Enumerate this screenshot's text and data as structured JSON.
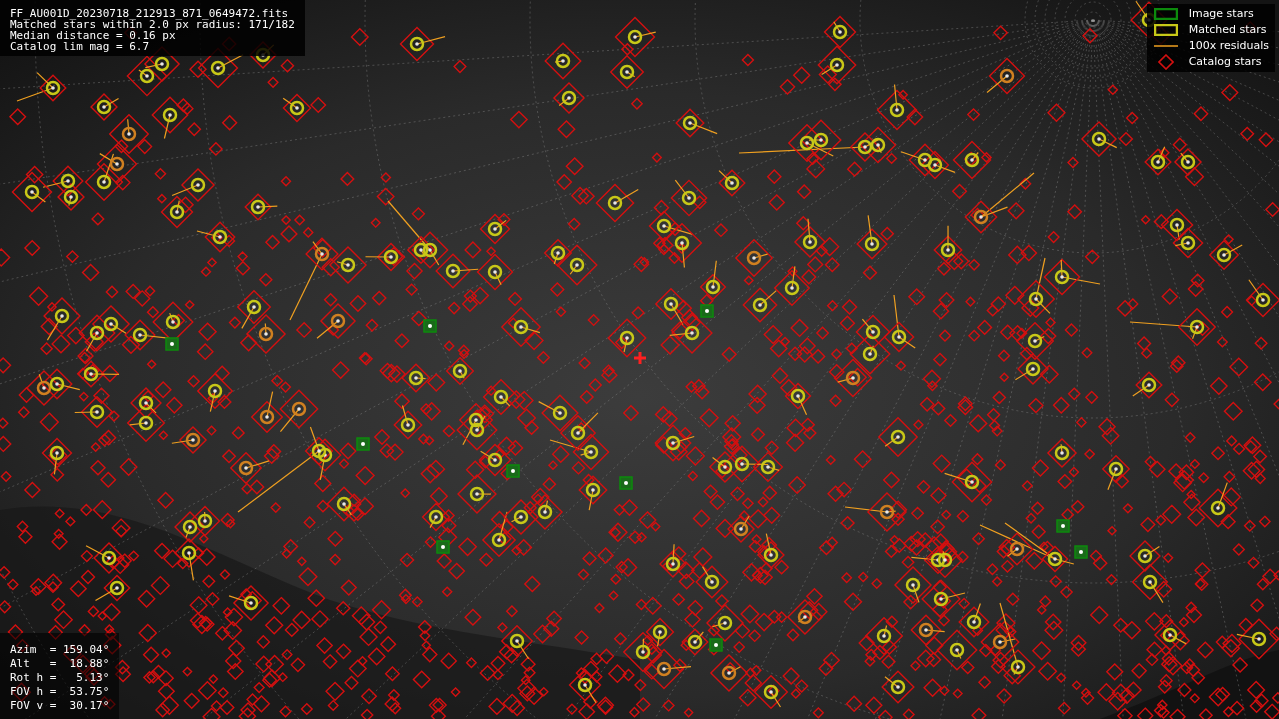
{
  "info_panel": {
    "lines": [
      "FF_AU001D_20230718_212913_871_0649472.fits",
      "Matched stars within 2.0 px radius: 171/182",
      "Median distance = 0.16 px",
      "Catalog lim mag = 6.7"
    ]
  },
  "legend": {
    "items": [
      {
        "label": "Image stars",
        "kind": "image"
      },
      {
        "label": "Matched stars",
        "kind": "matched"
      },
      {
        "label": "100x residuals",
        "kind": "residual"
      },
      {
        "label": "Catalog stars",
        "kind": "catalog"
      }
    ]
  },
  "pointing": {
    "lines": [
      "Azim  = 159.04°",
      "Alt   =  18.88°",
      "Rot h =   5.13°",
      "FOV h =  53.75°",
      "FOV v =  30.17°"
    ]
  }
}
